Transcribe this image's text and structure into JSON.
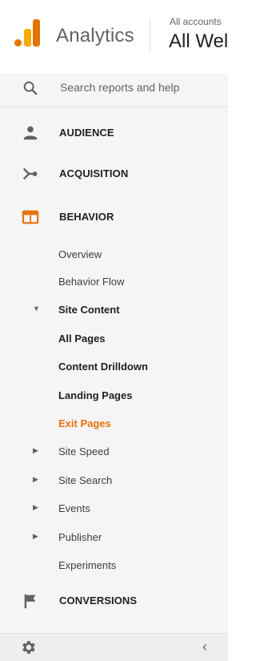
{
  "header": {
    "app_name": "Analytics",
    "account_small": "All accounts",
    "account_big": "All Wel"
  },
  "nav": {
    "search_label": "Search reports and help",
    "sections": [
      {
        "label": "AUDIENCE",
        "icon": "person-icon"
      },
      {
        "label": "ACQUISITION",
        "icon": "acquisition-icon"
      },
      {
        "label": "BEHAVIOR",
        "icon": "behavior-icon"
      }
    ],
    "behavior_items": [
      {
        "label": "Overview"
      },
      {
        "label": "Behavior Flow"
      },
      {
        "label": "Site Content",
        "expanded": true
      },
      {
        "label": "All Pages"
      },
      {
        "label": "Content Drilldown"
      },
      {
        "label": "Landing Pages"
      },
      {
        "label": "Exit Pages",
        "active": true
      },
      {
        "label": "Site Speed"
      },
      {
        "label": "Site Search"
      },
      {
        "label": "Events"
      },
      {
        "label": "Publisher"
      },
      {
        "label": "Experiments"
      }
    ],
    "conversions_label": "CONVERSIONS"
  },
  "colors": {
    "accent": "#e8710a",
    "nav_bg": "#f5f5f5"
  }
}
